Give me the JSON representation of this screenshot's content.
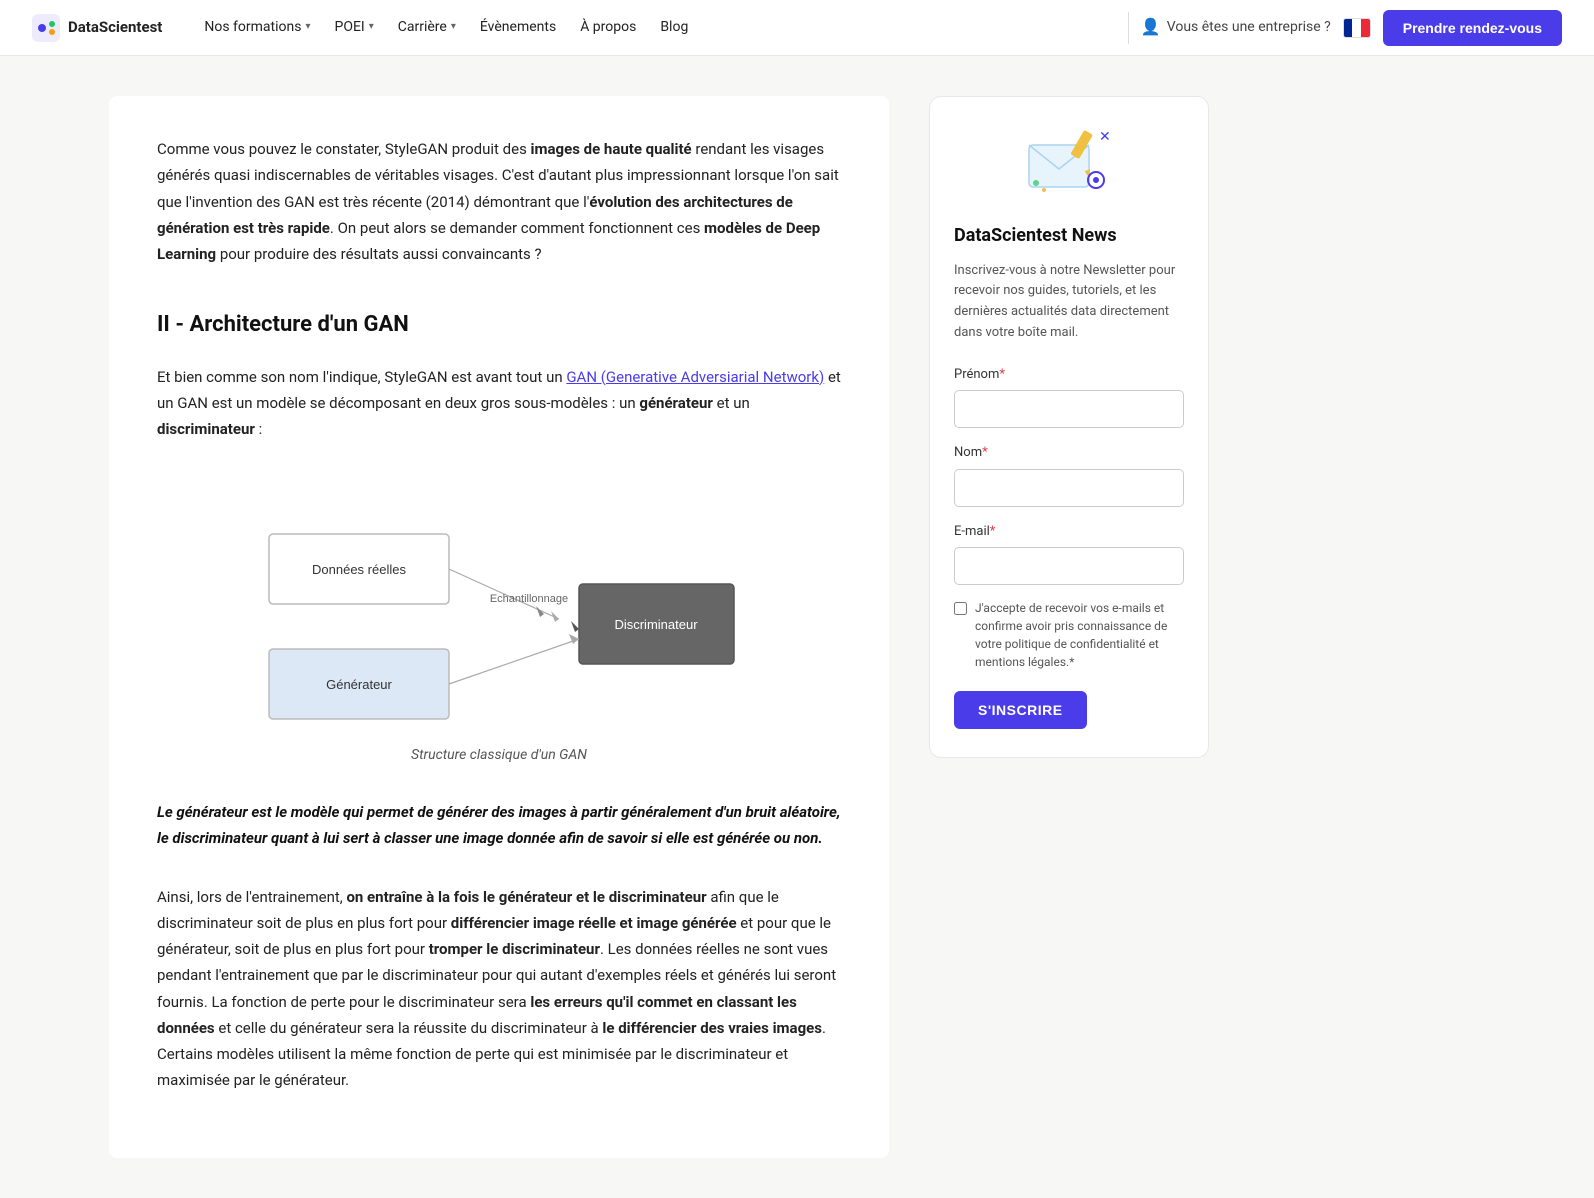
{
  "nav": {
    "logo_text": "DataScientest",
    "items": [
      {
        "label": "Nos formations",
        "has_dropdown": true
      },
      {
        "label": "POEI",
        "has_dropdown": true
      },
      {
        "label": "Carrière",
        "has_dropdown": true
      },
      {
        "label": "Évènements",
        "has_dropdown": false
      },
      {
        "label": "À propos",
        "has_dropdown": false
      },
      {
        "label": "Blog",
        "has_dropdown": false
      }
    ],
    "enterprise_label": "Vous êtes une entreprise ?",
    "cta_label": "Prendre rendez-vous"
  },
  "main": {
    "intro_paragraph": "Comme vous pouvez le constater, StyleGAN produit des images de haute qualité rendant les visages générés quasi indiscernables de véritables visages. C'est d'autant plus impressionnant lorsque l'on sait que l'invention des GAN est très récente (2014) démontrant que l'évolution des architectures de génération est très rapide. On peut alors se demander comment fonctionnent ces modèles de Deep Learning pour produire des résultats aussi convaincants ?",
    "section_title": "II - Architecture d'un GAN",
    "body_text_1_before": "Et bien comme son nom l'indique, StyleGAN est avant tout un ",
    "body_text_1_link": "GAN (Generative Adversiarial Network)",
    "body_text_1_link_href": "#",
    "body_text_1_after": " et un GAN est un modèle se décomposant en deux gros sous-modèles : un générateur et un discriminateur :",
    "diagram_label_donnees": "Données réelles",
    "diagram_label_echantillonnage": "Echantillonnage",
    "diagram_label_discriminateur": "Discriminateur",
    "diagram_label_generateur": "Générateur",
    "diagram_caption": "Structure classique d'un GAN",
    "highlight_text": "Le générateur est le modèle qui permet de générer des images à partir généralement d'un bruit aléatoire, le discriminateur quant à lui sert à classer une image donnée afin de savoir si elle est générée ou non.",
    "body_text_2": "Ainsi, lors de l'entrainement, on entraîne à la fois le générateur et le discriminateur afin que le discriminateur soit de plus en plus fort pour différencier image réelle et image générée et pour que le générateur, soit de plus en plus fort pour tromper le discriminateur. Les données réelles ne sont vues pendant l'entrainement que par le discriminateur pour qui autant d'exemples réels et générés lui seront fournis. La fonction de perte pour le discriminateur sera les erreurs qu'il commet en classant les données et celle du générateur sera la réussite du discriminateur à le différencier des vraies images. Certains modèles utilisent la même fonction de perte qui est minimisée par le discriminateur et maximisée par le générateur.",
    "body_text_2_bold_parts": [
      "on entraîne à la fois le générateur et le discriminateur",
      "différencier image réelle et image générée",
      "tromper le discriminateur",
      "les erreurs qu'il commet en classant les données",
      "le différencier des vraies images"
    ]
  },
  "sidebar": {
    "newsletter_title": "DataScientest News",
    "newsletter_desc": "Inscrivez-vous à notre Newsletter pour recevoir nos guides, tutoriels, et les dernières actualités data directement dans votre boîte mail.",
    "prenom_label": "Prénom",
    "prenom_required": "*",
    "nom_label": "Nom",
    "nom_required": "*",
    "email_label": "E-mail",
    "email_required": "*",
    "checkbox_label": "J'accepte de recevoir vos e-mails et confirme avoir pris connaissance de votre politique de confidentialité et mentions légales.",
    "checkbox_required": "*",
    "subscribe_label": "S'INSCRIRE"
  }
}
